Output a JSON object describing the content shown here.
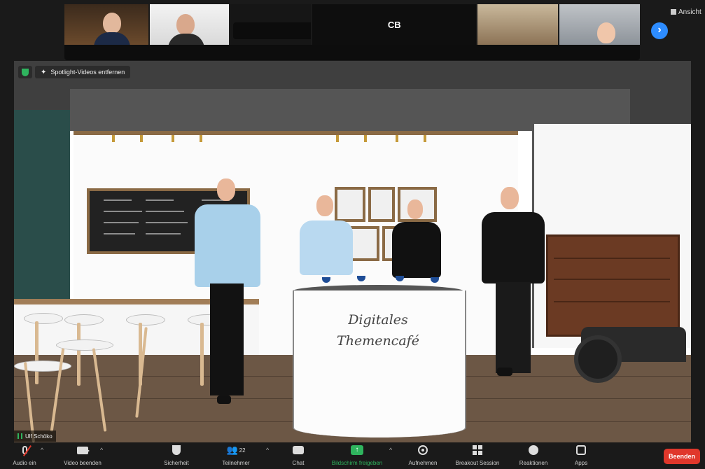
{
  "gallery": {
    "tiles": [
      {
        "id": "t1",
        "name": ""
      },
      {
        "id": "t2",
        "name": ""
      },
      {
        "id": "t3",
        "name": ""
      },
      {
        "id": "t4",
        "name": "CB"
      },
      {
        "id": "t5",
        "name": ""
      },
      {
        "id": "t6",
        "name": ""
      }
    ],
    "next_icon": "›",
    "view_label": "Ansicht"
  },
  "meeting": {
    "spotlight_label": "Spotlight-Videos entfernen",
    "speaker_name": "Ulf Schöko",
    "table_text": "Digitales\nThemencafé"
  },
  "toolbar": {
    "audio": "Audio ein",
    "video": "Video beenden",
    "security": "Sicherheit",
    "participants": "Teilnehmer",
    "participants_count": "22",
    "chat": "Chat",
    "share": "Bildschirm freigeben",
    "record": "Aufnehmen",
    "breakout": "Breakout Session",
    "reactions": "Reaktionen",
    "apps": "Apps",
    "end": "Beenden",
    "caret": "^"
  },
  "colors": {
    "accent_blue": "#2d8cff",
    "share_green": "#2fb45e",
    "end_red": "#e0372b"
  }
}
